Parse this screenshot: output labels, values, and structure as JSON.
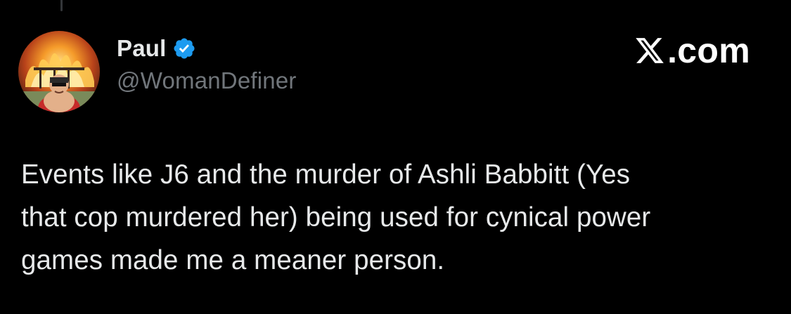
{
  "author": {
    "display_name": "Paul",
    "handle": "@WomanDefiner",
    "verified": true,
    "avatar": "cartoon-man-fire-avatar"
  },
  "brand": {
    "logo": "x-logo-icon",
    "text": ".com"
  },
  "tweet": {
    "lines": [
      "Events like J6 and the murder of Ashli Babbitt (Yes",
      "that cop murdered her) being used for cynical power",
      "games made me a meaner person."
    ]
  },
  "colors": {
    "background": "#000000",
    "text_primary": "#e7e9ea",
    "text_secondary": "#71767b",
    "verified_blue": "#1d9bf0"
  }
}
